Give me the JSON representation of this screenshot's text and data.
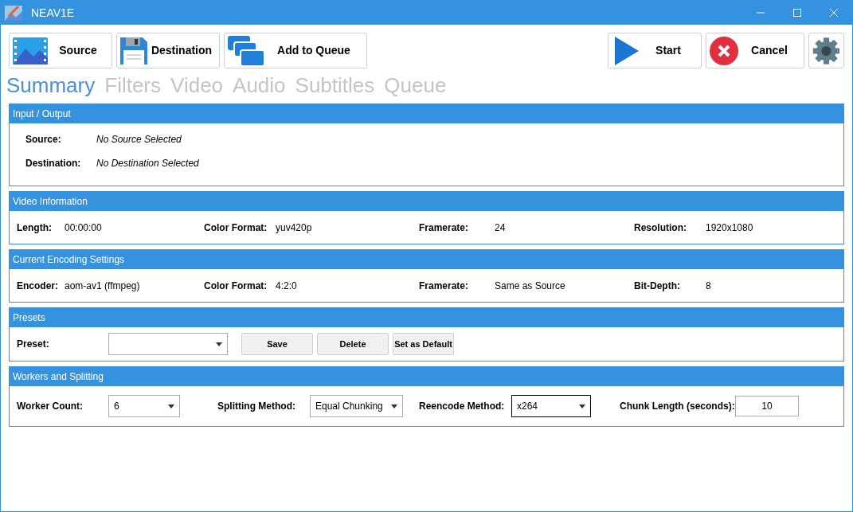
{
  "window": {
    "title": "NEAV1E"
  },
  "toolbar": [
    {
      "kind": "source",
      "label": "Source"
    },
    {
      "kind": "destination",
      "label": "Destination"
    },
    {
      "kind": "queue",
      "label": "Add to Queue"
    },
    {
      "kind": "start",
      "label": "Start"
    },
    {
      "kind": "cancel",
      "label": "Cancel"
    },
    {
      "kind": "settings"
    }
  ],
  "tabs": [
    {
      "label": "Summary",
      "selected": true
    },
    {
      "label": "Filters",
      "selected": false
    },
    {
      "label": "Video",
      "selected": false
    },
    {
      "label": "Audio",
      "selected": false
    },
    {
      "label": "Subtitles",
      "selected": false
    },
    {
      "label": "Queue",
      "selected": false
    }
  ],
  "sections": [
    {
      "kind": "stack",
      "title": "Input / Output",
      "fields": [
        {
          "label": "Source:",
          "value": "No Source Selected"
        },
        {
          "label": "Destination:",
          "value": "No Destination Selected"
        }
      ]
    },
    {
      "kind": "grid",
      "title": "Video Information",
      "fields": [
        {
          "label": "Length:",
          "value": "00:00:00"
        },
        {
          "label": "Color Format:",
          "value": "yuv420p"
        },
        {
          "label": "Framerate:",
          "value": "24"
        },
        {
          "label": "Resolution:",
          "value": "1920x1080"
        }
      ]
    },
    {
      "kind": "grid",
      "title": "Current Encoding Settings",
      "fields": [
        {
          "label": "Encoder:",
          "value": "aom-av1 (ffmpeg)"
        },
        {
          "label": "Color Format:",
          "value": "4:2:0"
        },
        {
          "label": "Framerate:",
          "value": "Same as Source"
        },
        {
          "label": "Bit-Depth:",
          "value": "8"
        }
      ]
    },
    {
      "kind": "presets",
      "title": "Presets",
      "label": "Preset:",
      "buttons": [
        "Save",
        "Delete",
        "Set as Default"
      ]
    },
    {
      "kind": "controls",
      "title": "Workers and Splitting",
      "fields": [
        {
          "kind": "dropdown",
          "label": "Worker Count:",
          "value": "6",
          "focused": false
        },
        {
          "kind": "dropdown",
          "label": "Splitting Method:",
          "value": "Equal Chunking",
          "focused": false
        },
        {
          "kind": "dropdown",
          "label": "Reencode Method:",
          "value": "x264",
          "focused": true
        },
        {
          "kind": "input",
          "label": "Chunk Length (seconds):",
          "value": "10",
          "focused": false
        }
      ]
    }
  ]
}
